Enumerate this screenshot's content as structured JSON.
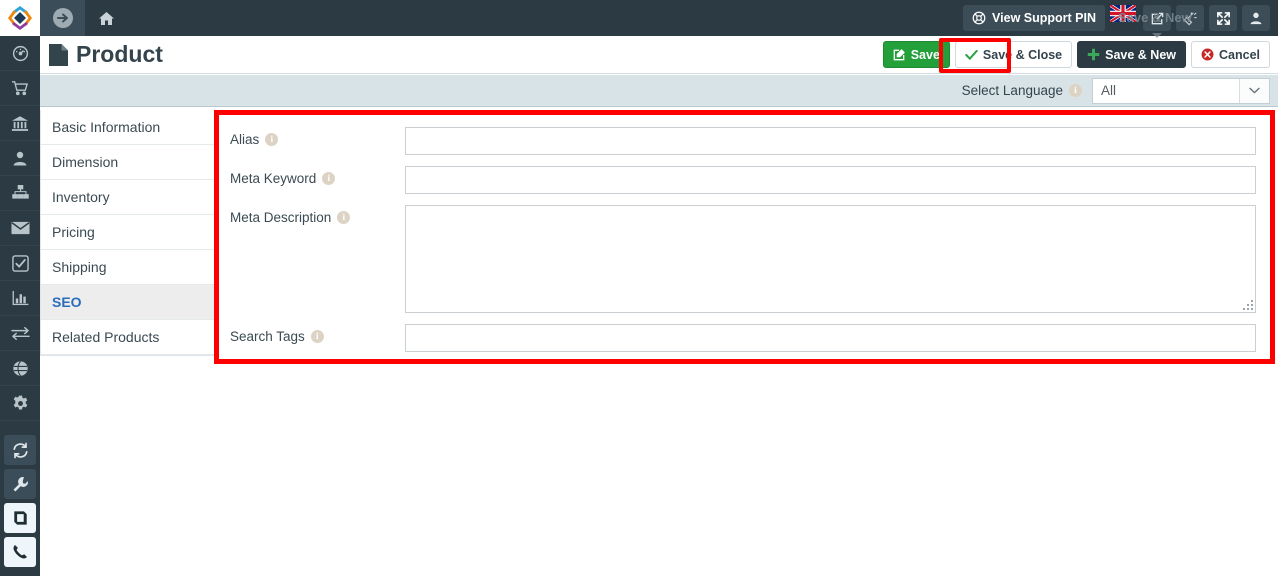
{
  "topbar": {
    "logo_icon": "diamond-logo-icon",
    "forward_icon": "arrow-circle-right-icon",
    "home_icon": "home-icon",
    "support_pin_label": "View Support PIN",
    "support_pin_icon": "lifebuoy-icon",
    "flag_icon": "uk-flag-icon",
    "external_link_icon": "external-link-icon",
    "clear-cache_icon": "broom-icon",
    "fullscreen_icon": "expand-icon",
    "user_icon": "user-icon",
    "ghost_tooltip": "Save & New"
  },
  "rail": {
    "items": [
      {
        "name": "dashboard",
        "icon": "speedometer-icon",
        "style": "plain"
      },
      {
        "name": "sales",
        "icon": "shopping-cart-icon",
        "style": "plain"
      },
      {
        "name": "accounting",
        "icon": "bank-icon",
        "style": "plain"
      },
      {
        "name": "customers",
        "icon": "user-icon",
        "style": "plain"
      },
      {
        "name": "organization",
        "icon": "sitemap-icon",
        "style": "plain"
      },
      {
        "name": "messages",
        "icon": "envelope-icon",
        "style": "plain"
      },
      {
        "name": "tasks",
        "icon": "check-square-icon",
        "style": "plain"
      },
      {
        "name": "reports",
        "icon": "bar-chart-icon",
        "style": "plain"
      },
      {
        "name": "transfers",
        "icon": "exchange-arrows-icon",
        "style": "plain"
      },
      {
        "name": "website",
        "icon": "globe-icon",
        "style": "plain"
      },
      {
        "name": "settings",
        "icon": "gear-icon",
        "style": "plain"
      },
      {
        "name": "sync",
        "icon": "refresh-icon",
        "style": "boxed"
      },
      {
        "name": "tools",
        "icon": "wrench-icon",
        "style": "boxed"
      },
      {
        "name": "catalog",
        "icon": "book-icon",
        "style": "light"
      },
      {
        "name": "phone",
        "icon": "phone-icon",
        "style": "light"
      }
    ]
  },
  "page": {
    "title": "Product",
    "title_icon": "file-icon"
  },
  "actions": {
    "save": {
      "label": "Save",
      "icon": "edit-square-icon"
    },
    "save_close": {
      "label": "Save & Close",
      "icon": "check-icon"
    },
    "save_new": {
      "label": "Save & New",
      "icon": "plus-icon"
    },
    "cancel": {
      "label": "Cancel",
      "icon": "times-circle-icon"
    }
  },
  "language": {
    "label": "Select Language",
    "info_icon": "info-icon",
    "value": "All",
    "caret_icon": "chevron-down-icon"
  },
  "sidetabs": {
    "items": [
      {
        "label": "Basic Information",
        "active": false
      },
      {
        "label": "Dimension",
        "active": false
      },
      {
        "label": "Inventory",
        "active": false
      },
      {
        "label": "Pricing",
        "active": false
      },
      {
        "label": "Shipping",
        "active": false
      },
      {
        "label": "SEO",
        "active": true
      },
      {
        "label": "Related Products",
        "active": false
      }
    ]
  },
  "form": {
    "fields": [
      {
        "label": "Alias",
        "type": "input",
        "value": "",
        "info_icon": "info-icon"
      },
      {
        "label": "Meta Keyword",
        "type": "input",
        "value": "",
        "info_icon": "info-icon"
      },
      {
        "label": "Meta Description",
        "type": "textarea",
        "value": "",
        "info_icon": "info-icon"
      },
      {
        "label": "Search Tags",
        "type": "input",
        "value": "",
        "info_icon": "info-icon"
      }
    ]
  },
  "colors": {
    "highlight": "#ff0000",
    "dark_chrome": "#2b3a43",
    "accent_green": "#24a03b",
    "active_tab_text": "#2a6ebb",
    "lang_bar": "#d8e3e8"
  }
}
